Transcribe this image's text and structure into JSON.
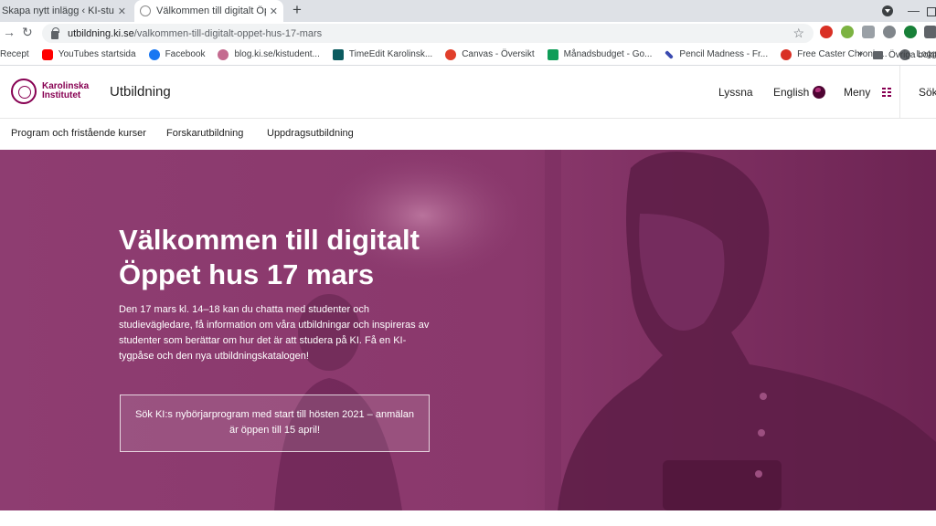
{
  "browser": {
    "tabs": [
      {
        "title": "Skapa nytt inlägg ‹ KI-studenten",
        "close": "✕"
      },
      {
        "title": "Välkommen till digitalt Öppet hus",
        "close": "✕"
      }
    ],
    "new_tab": "+",
    "minimize": "—",
    "nav": {
      "back": "←",
      "forward": "→",
      "reload": "↻"
    },
    "url_domain": "utbildning.ki.se",
    "url_path": "/valkommen-till-digitalt-oppet-hus-17-mars",
    "bookmark_star": "☆",
    "bookmarks": [
      {
        "label": "Recept",
        "icon": "none",
        "color": "#ffffff"
      },
      {
        "label": "YouTubes startsida",
        "icon": "youtube-icon",
        "color": "#ff0000"
      },
      {
        "label": "Facebook",
        "icon": "facebook-icon",
        "color": "#1877f2"
      },
      {
        "label": "blog.ki.se/kistudent...",
        "icon": "ki-blog-icon",
        "color": "#c46a8f"
      },
      {
        "label": "TimeEdit Karolinsk...",
        "icon": "timeedit-icon",
        "color": "#0b5b5f"
      },
      {
        "label": "Canvas - Översikt",
        "icon": "canvas-icon",
        "color": "#e13f2b"
      },
      {
        "label": "Månadsbudget - Go...",
        "icon": "sheets-icon",
        "color": "#0f9d58"
      },
      {
        "label": "Pencil Madness - Fr...",
        "icon": "pencil-icon",
        "color": "#3b4bb0"
      },
      {
        "label": "Free Caster Chronic...",
        "icon": "caster-icon",
        "color": "#d93025"
      },
      {
        "label": "Logga in",
        "icon": "login-icon",
        "color": "#5f6368"
      }
    ],
    "bookmarks_overflow": "»",
    "other_bookmarks": "Övriga bokmärken"
  },
  "site": {
    "logo_line1": "Karolinska",
    "logo_line2": "Institutet",
    "section_title": "Utbildning",
    "header_links": {
      "listen": "Lyssna",
      "language": "English",
      "menu": "Meny",
      "search": "Sök"
    },
    "subnav": [
      "Program och fristående kurser",
      "Forskarutbildning",
      "Uppdragsutbildning"
    ]
  },
  "hero": {
    "title_line1": "Välkommen till digitalt",
    "title_line2": "Öppet hus 17 mars",
    "body": "Den 17 mars kl. 14–18 kan du chatta med studenter och studievägledare, få information om våra utbildningar och inspireras av studenter som berättar om hur det är att studera på KI. Få en KI-tygpåse och den nya utbildningskatalogen!",
    "cta": "Sök KI:s nybörjarprogram med start till hösten 2021 – anmälan är öppen till 15 april!"
  },
  "colors": {
    "brand": "#870052",
    "hero_overlay": "#8b3a6e"
  }
}
